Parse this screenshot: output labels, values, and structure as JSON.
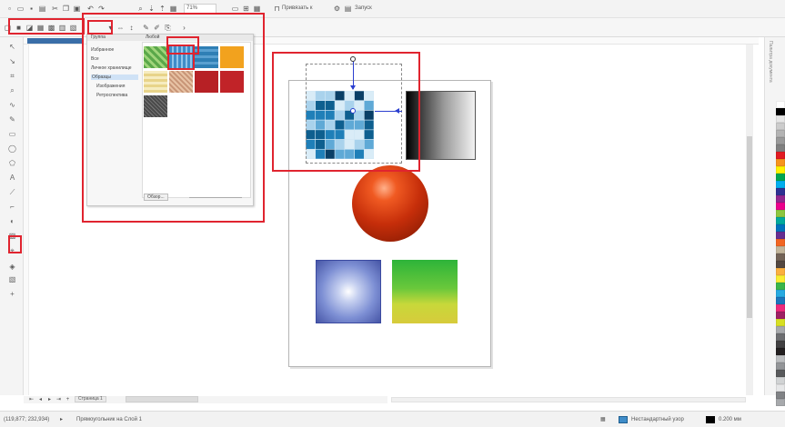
{
  "toolbar": {
    "zoom_value": "71%",
    "snap_label": "Привязать к",
    "launch_label": "Запуск"
  },
  "property_bar": {
    "fill_type_icon": "fill-pattern-icon"
  },
  "fill_popup": {
    "header_label": "Группа",
    "grid_header": "Любой",
    "categories": [
      "Избранное",
      "Все",
      "Личное хранилище",
      "Образцы",
      "Изображения",
      "Ретроспектива"
    ],
    "selected_category_index": 3,
    "tile_colors": [
      [
        "#5aa84a",
        "#3f8cc8",
        "#2f7fb5",
        "#f2a21e"
      ],
      [
        "#e8d48a",
        "#e7c2a4",
        "#b72025",
        "#c12328"
      ],
      [
        "#4a4a4a"
      ]
    ],
    "footer_button": "Обзор...",
    "footer_slider_icon": "slider-icon"
  },
  "pattern_square": {
    "colors": [
      "#0e5f8f",
      "#1f7fb8",
      "#5fa9d6",
      "#a9d2ec",
      "#d9ecf7",
      "#0a3f66"
    ]
  },
  "page_tabs": {
    "page_label": "Страница 1"
  },
  "status": {
    "coords": "(119,877; 232,934)",
    "hint": "Прямоугольник на Слой 1",
    "fill_label": "Нестандартный узор",
    "outline_value": "0.200 мм"
  },
  "palette": {
    "title": "Палитра документа",
    "colors": [
      "#ffffff",
      "#000000",
      "#e6e6e6",
      "#cccccc",
      "#b3b3b3",
      "#999999",
      "#808080",
      "#e11b22",
      "#f7941d",
      "#fff200",
      "#00a651",
      "#00aeef",
      "#2e3192",
      "#92278f",
      "#ec008c",
      "#8dc63f",
      "#00a99d",
      "#0072bc",
      "#662d91",
      "#f26522",
      "#c2b59b",
      "#736357",
      "#534741",
      "#fbb040",
      "#f9ed32",
      "#39b54a",
      "#27aae1",
      "#1b75bc",
      "#ee2a7b",
      "#9e1f63",
      "#d7df23",
      "#a7a9ac",
      "#6d6e71",
      "#414042",
      "#231f20",
      "#bcbec0",
      "#939598",
      "#58595b",
      "#d1d3d4",
      "#e6e7e8",
      "#808285",
      "#a7a9ac"
    ]
  },
  "highlight_color": "#e0242f"
}
